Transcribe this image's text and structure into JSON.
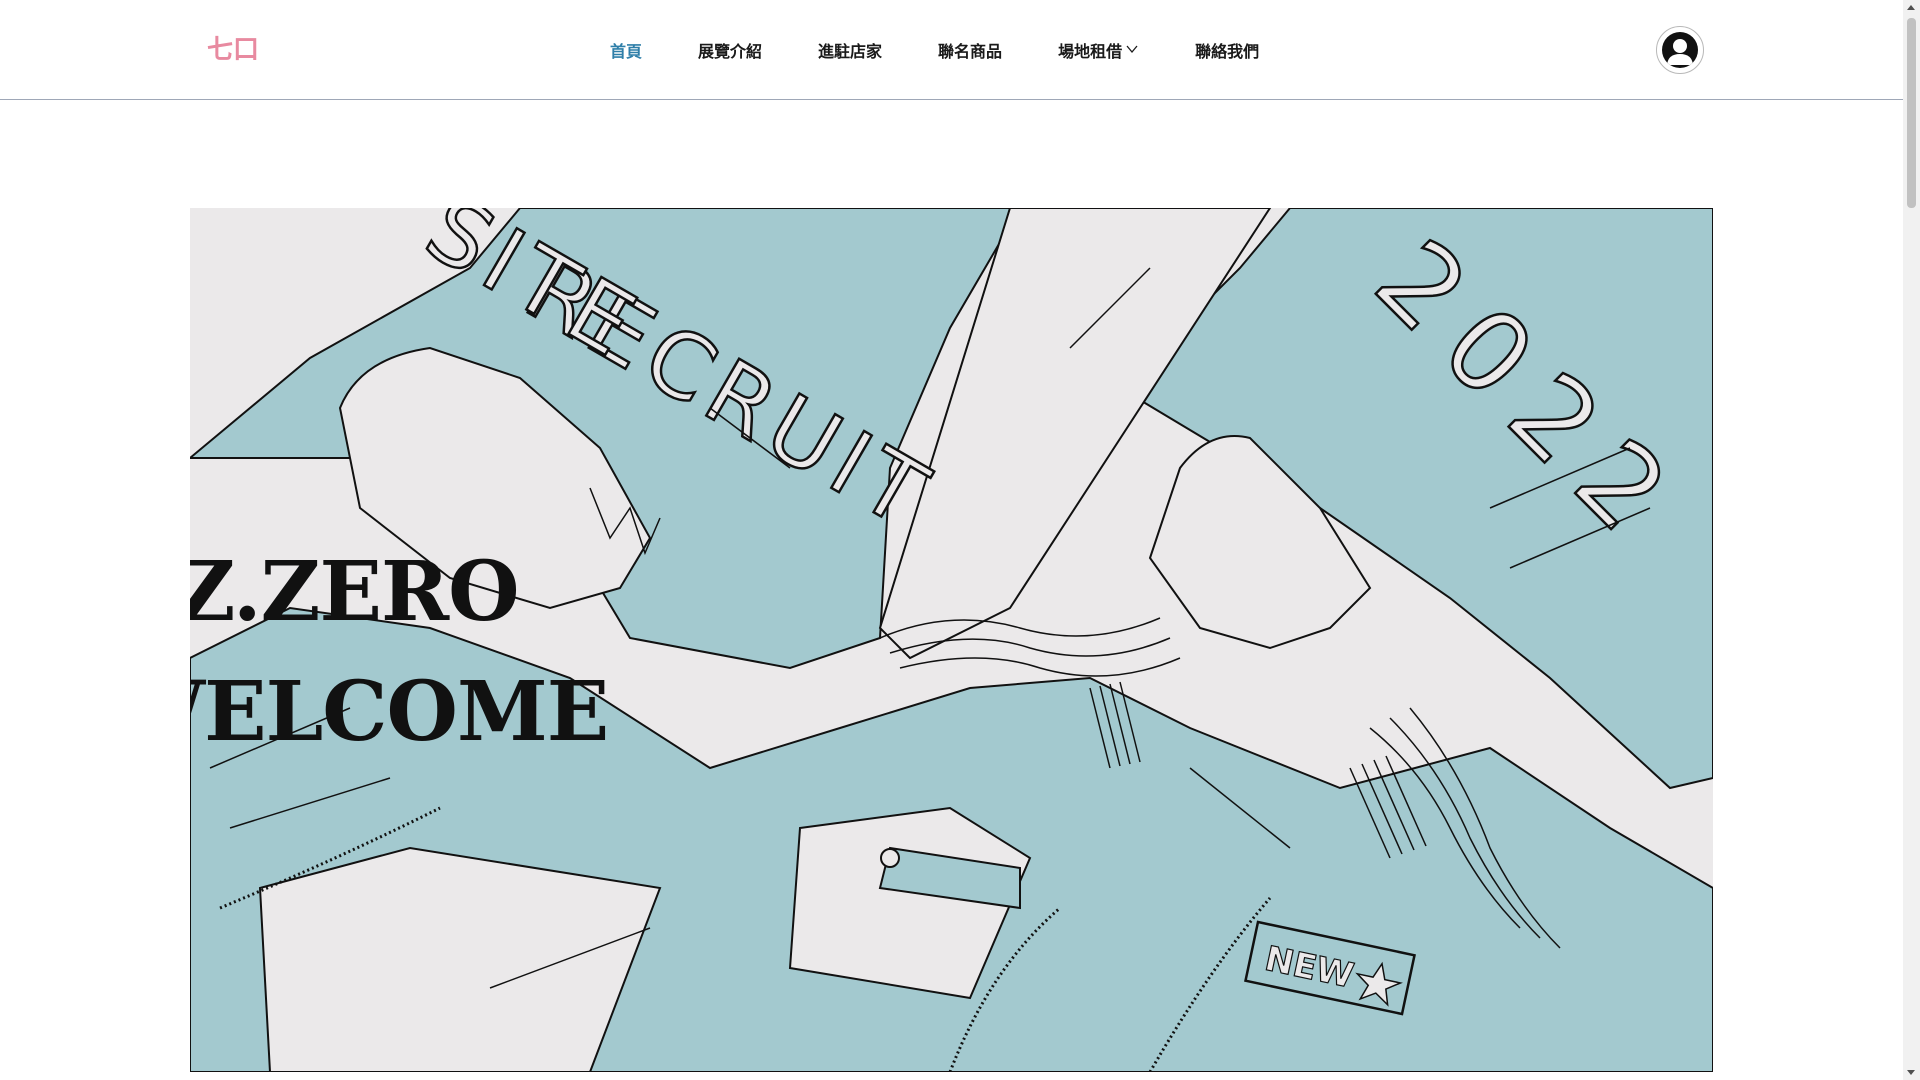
{
  "header": {
    "logo_text": "七口",
    "nav": [
      {
        "label": "首頁",
        "active": true
      },
      {
        "label": "展覽介紹"
      },
      {
        "label": "進駐店家"
      },
      {
        "label": "聯名商品"
      },
      {
        "label": "場地租借",
        "has_dropdown": true
      },
      {
        "label": "聯絡我們"
      }
    ],
    "user_icon": "user-avatar-icon"
  },
  "hero": {
    "line1": "AZ.ZERO",
    "line2": "WELCOME",
    "illustration_text_1": "RECRUIT",
    "illustration_text_2": "SITE",
    "illustration_text_3": "2022",
    "patch_text": "NEW"
  },
  "colors": {
    "accent": "#2f7fa9",
    "illustration_teal": "#a3c9cf",
    "illustration_bg": "#ebe9ea",
    "logo_pink": "#e88aa0"
  }
}
